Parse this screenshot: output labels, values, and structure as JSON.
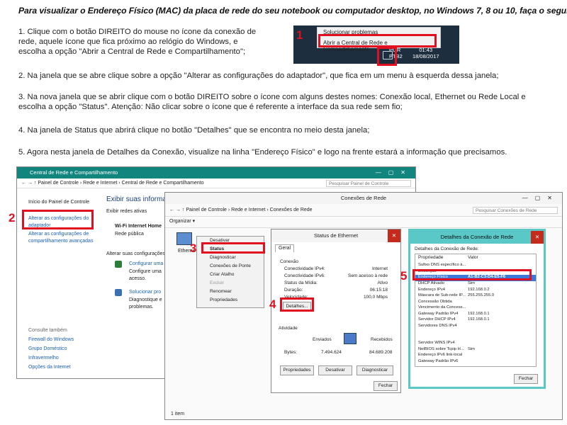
{
  "title": "Para visualizar o Endereço Físico (MAC) da placa de rede do seu notebook ou computador desktop, no Windows 7, 8 ou 10, faça o seguinte:",
  "steps": [
    "1. Clique com o botão DIREITO do mouse no ícone da conexão de rede, aquele ícone que fica próximo ao relógio do Windows, e  escolha a opção \"Abrir a Central de Rede e Compartilhamento\";",
    "2. Na janela que se abre clique sobre a opção \"Alterar as configurações do adaptador\", que fica em um menu à esquerda dessa janela;",
    "3. Na nova janela que se abrir clique com o botão DIREITO sobre o ícone com alguns destes nomes: Conexão local, Ethernet ou Rede Local e escolha a opção \"Status\". Atenção: Não clicar sobre o ícone que é referente a interface da sua rede sem fio;",
    "4. Na janela de Status que abrirá clique no botão \"Detalhes\" que se encontra no meio desta janela;",
    "5. Agora nesta janela de Detalhes da Conexão, visualize na linha \"Endereço Físico\" e logo na frente estará a informação que precisamos."
  ],
  "badges": {
    "b1": "1",
    "b2": "2",
    "b3": "3",
    "b4": "4",
    "b5": "5"
  },
  "taskbar": {
    "menu_items": [
      "Solucionar problemas",
      "Abrir a Central de Rede e Compartilhamento"
    ],
    "lang": "POR\nPTB2",
    "time": "01:43",
    "date": "18/08/2017"
  },
  "central": {
    "title": "Central de Rede e Compartilhamento",
    "path": "Painel de Controle  ›  Rede e Internet  ›  Central de Rede e Compartilhamento",
    "search": "Pesquisar Painel de Controle",
    "sidebar_home": "Início do Painel de Controle",
    "sidebar_links": [
      "Alterar as configurações do adaptador",
      "Alterar as configurações de compartilhamento avançadas"
    ],
    "see_also_title": "Consulte também",
    "see_also": [
      "Firewall do Windows",
      "Grupo Doméstico",
      "Infravermelho",
      "Opções da Internet"
    ],
    "heading": "Exibir suas informa",
    "active_label": "Exibir redes ativas",
    "network_name": "Wi-Fi Internet Home",
    "network_type": "Rede pública",
    "change_label": "Alterar suas configurações d",
    "configure_link": "Configurar uma",
    "configure_desc": "Configure uma acesso.",
    "troubleshoot_link": "Solucionar pro",
    "troubleshoot_desc": "Diagnostique e problemas."
  },
  "conexoes": {
    "title": "Conexões de Rede",
    "path": "Painel de Controle  ›  Rede e Internet  ›  Conexões de Rede",
    "search": "Pesquisar Conexões de Rede",
    "organize": "Organizar ▾",
    "icon_label": "Etherne",
    "status_bar": "1 item"
  },
  "context_menu": [
    "Desativar",
    "Status",
    "Diagnosticar",
    "Conexões de Ponte",
    "Criar Atalho",
    "Excluir",
    "Renomear",
    "Propriedades"
  ],
  "status_eth": {
    "title": "Status de Ethernet",
    "tab": "Geral",
    "section_conn": "Conexão",
    "rows": [
      {
        "label": "Conectividade IPv4:",
        "value": "Internet"
      },
      {
        "label": "Conectividade IPv6:",
        "value": "Sem acesso à rede"
      },
      {
        "label": "Status da Mídia:",
        "value": "Ativo"
      },
      {
        "label": "Duração:",
        "value": "06:15:18"
      },
      {
        "label": "Velocidade:",
        "value": "100,0 Mbps"
      }
    ],
    "details_btn": "Detalhes...",
    "section_activity": "Atividade",
    "sent": "Enviados",
    "received": "Recebidos",
    "bytes_label": "Bytes:",
    "bytes_sent": "7.494.624",
    "bytes_recv": "84.689.208",
    "btn_props": "Propriedades",
    "btn_disable": "Desativar",
    "btn_diag": "Diagnosticar",
    "btn_close": "Fechar"
  },
  "details": {
    "title": "Detalhes da Conexão de Rede",
    "subtitle": "Detalhes da Conexão de Rede:",
    "col_prop": "Propriedade",
    "col_value": "Valor",
    "rows": [
      {
        "p": "Sufixo DNS específico à...",
        "v": ""
      },
      {
        "p": "Descrição",
        "v": ""
      },
      {
        "p": "Endereço Físico",
        "v": "A1-B2-C3-D4-E5-F6"
      },
      {
        "p": "DHCP Ativado",
        "v": "Sim"
      },
      {
        "p": "Endereço IPv4",
        "v": "192.168.0.2"
      },
      {
        "p": "Máscara de Sub-rede IP...",
        "v": "255.255.255.0"
      },
      {
        "p": "Concessão Obtida",
        "v": ""
      },
      {
        "p": "Vencimento da Concess...",
        "v": ""
      },
      {
        "p": "Gateway Padrão IPv4",
        "v": "192.168.0.1"
      },
      {
        "p": "Servidor DHCP IPv4",
        "v": "192.168.0.1"
      },
      {
        "p": "Servidores DNS IPv4",
        "v": ""
      },
      {
        "p": "",
        "v": ""
      },
      {
        "p": "Servidor WINS IPv4",
        "v": ""
      },
      {
        "p": "NetBIOS sobre Tcpip H...",
        "v": "Sim"
      },
      {
        "p": "Endereço IPv6 link-local",
        "v": ""
      },
      {
        "p": "Gateway Padrão IPv6",
        "v": ""
      }
    ],
    "btn_close": "Fechar"
  },
  "colors": {
    "accent_red": "#e01020",
    "teal": "#12857f",
    "highlight": "#3b78d8"
  }
}
